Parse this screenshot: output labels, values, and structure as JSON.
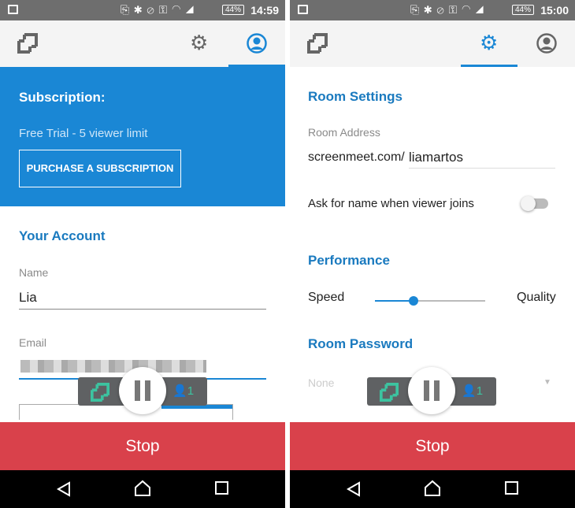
{
  "left": {
    "status": {
      "time": "14:59",
      "battery": "44%"
    },
    "subscription": {
      "title": "Subscription:",
      "plan": "Free Trial - 5 viewer limit",
      "purchase_label": "PURCHASE A SUBSCRIPTION"
    },
    "account": {
      "title": "Your Account",
      "name_label": "Name",
      "name_value": "Lia",
      "email_label": "Email"
    },
    "controls": {
      "viewer_count": "1"
    },
    "stop_label": "Stop"
  },
  "right": {
    "status": {
      "time": "15:00",
      "battery": "44%"
    },
    "room_settings": {
      "title": "Room Settings",
      "address_label": "Room Address",
      "address_prefix": "screenmeet.com/",
      "address_value": "liamartos",
      "ask_name_label": "Ask for name when viewer joins",
      "ask_name_enabled": false
    },
    "performance": {
      "title": "Performance",
      "speed_label": "Speed",
      "quality_label": "Quality",
      "slider_value": 0.35
    },
    "password": {
      "title": "Room Password",
      "value": "None"
    },
    "controls": {
      "viewer_count": "1"
    },
    "stop_label": "Stop"
  },
  "colors": {
    "accent": "#1a87d5",
    "stop": "#d9414b",
    "controls_icon": "#3cc3a0"
  }
}
